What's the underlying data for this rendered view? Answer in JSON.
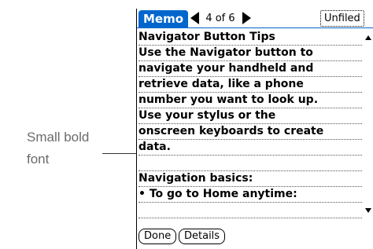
{
  "callout": {
    "text": "Small bold font"
  },
  "titlebar": {
    "app_title": "Memo",
    "position": "4 of 6",
    "category": "Unfiled",
    "prev_icon": "left-triangle",
    "next_icon": "right-triangle"
  },
  "memo": {
    "lines": [
      "Navigator Button Tips",
      "Use the Navigator button to",
      "navigate your handheld and",
      "retrieve data, like a phone",
      "number you want to look up.",
      "Use your stylus or the",
      "onscreen keyboards to create",
      "data.",
      "",
      "Navigation basics:",
      "• To go to Home anytime:",
      ""
    ]
  },
  "buttons": {
    "done": "Done",
    "details": "Details"
  }
}
